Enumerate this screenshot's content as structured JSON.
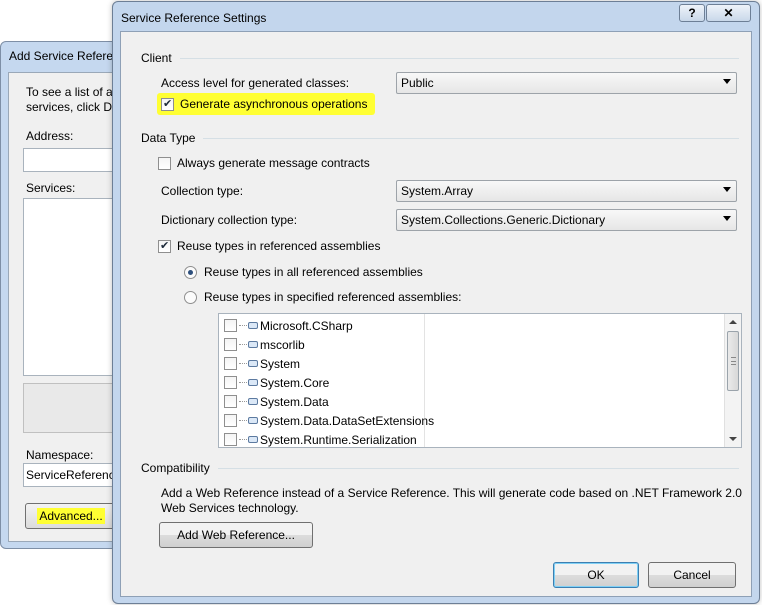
{
  "bg_dialog": {
    "title": "Add Service Referen",
    "intro_line1": "To see a list of av",
    "intro_line2": "services, click Dis",
    "address_label": "Address:",
    "services_label": "Services:",
    "namespace_label": "Namespace:",
    "namespace_value": "ServiceReference",
    "advanced_button": "Advanced..."
  },
  "dialog": {
    "title": "Service Reference Settings",
    "help_glyph": "?",
    "close_glyph": "✕"
  },
  "client": {
    "section_title": "Client",
    "access_level_label": "Access level for generated classes:",
    "access_level_value": "Public",
    "async_label": "Generate asynchronous operations",
    "async_checked": true
  },
  "data_type": {
    "section_title": "Data Type",
    "message_contracts_label": "Always generate message contracts",
    "message_contracts_checked": false,
    "collection_type_label": "Collection type:",
    "collection_type_value": "System.Array",
    "dictionary_type_label": "Dictionary collection type:",
    "dictionary_type_value": "System.Collections.Generic.Dictionary",
    "reuse_types_label": "Reuse types in referenced assemblies",
    "reuse_types_checked": true,
    "radio_all_label": "Reuse types in all referenced assemblies",
    "radio_specified_label": "Reuse types in specified referenced assemblies:",
    "selected_radio": "all",
    "assemblies": [
      "Microsoft.CSharp",
      "mscorlib",
      "System",
      "System.Core",
      "System.Data",
      "System.Data.DataSetExtensions",
      "System.Runtime.Serialization"
    ]
  },
  "compatibility": {
    "section_title": "Compatibility",
    "description_line1": "Add a Web Reference instead of a Service Reference. This will generate code based on .NET Framework 2.0",
    "description_line2": "Web Services technology.",
    "add_web_reference_button": "Add Web Reference..."
  },
  "footer": {
    "ok_button": "OK",
    "cancel_button": "Cancel"
  },
  "colors": {
    "highlight": "#ffff33",
    "window_frame": "#c3d6ed",
    "client_background": "#f0f0f0"
  }
}
